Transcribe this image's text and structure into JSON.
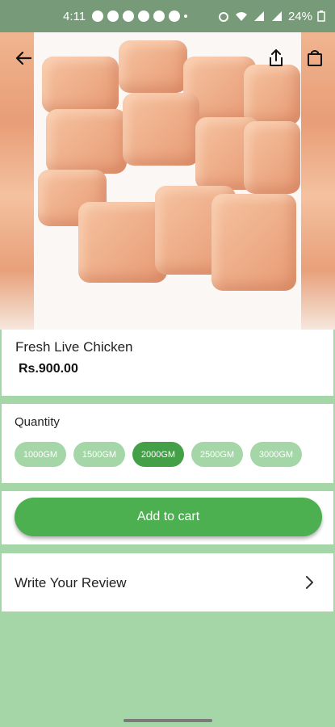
{
  "status_bar": {
    "time": "4:11",
    "battery": "24%"
  },
  "product": {
    "name": "Fresh Live Chicken",
    "price": "Rs.900.00"
  },
  "quantity": {
    "label": "Quantity",
    "options": [
      "1000GM",
      "1500GM",
      "2000GM",
      "2500GM",
      "3000GM"
    ],
    "selected": "2000GM"
  },
  "actions": {
    "add_to_cart": "Add to cart"
  },
  "review": {
    "label": "Write Your Review"
  },
  "colors": {
    "accent": "#4caf50",
    "chip": "#a5d6a7",
    "chip_selected": "#43a047",
    "background": "#a5d6a7"
  },
  "icons": [
    "back-arrow-icon",
    "share-icon",
    "shopping-bag-icon",
    "chevron-right-icon"
  ]
}
